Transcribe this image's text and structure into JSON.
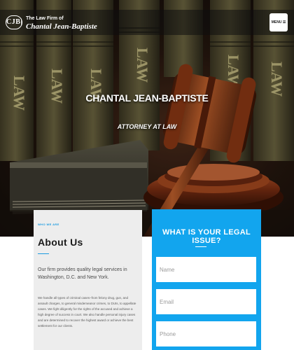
{
  "header": {
    "logo_text": "CJB|",
    "brand_small": "The Law Firm of",
    "brand_large": "Chantal Jean-Baptiste",
    "menu_label": "MENU ☰"
  },
  "hero": {
    "title": "CHANTAL JEAN-BAPTISTE",
    "subtitle": "ATTORNEY AT LAW",
    "book_spine_text": "LAW"
  },
  "about": {
    "kicker": "WHO WE ARE",
    "title": "About Us",
    "lead": "Our firm provides quality legal services in Washington, D.C. and New York.",
    "body": "We handle all types of criminal cases–from felony drug, gun, and assault charges, to general misdemeanor crimes, to DUIs, to appellate cases. We fight diligently for the rights of the accused and achieve a high degree of success in court. We also handle personal injury cases and are determined to recover the highest award or achieve the best settlement for our clients."
  },
  "form": {
    "title": "WHAT IS YOUR LEGAL ISSUE?",
    "name_placeholder": "Name",
    "email_placeholder": "Email",
    "phone_placeholder": "Phone"
  },
  "colors": {
    "accent": "#12a5ee",
    "about_bg": "#ededed",
    "hero_dark": "#1a120c"
  }
}
